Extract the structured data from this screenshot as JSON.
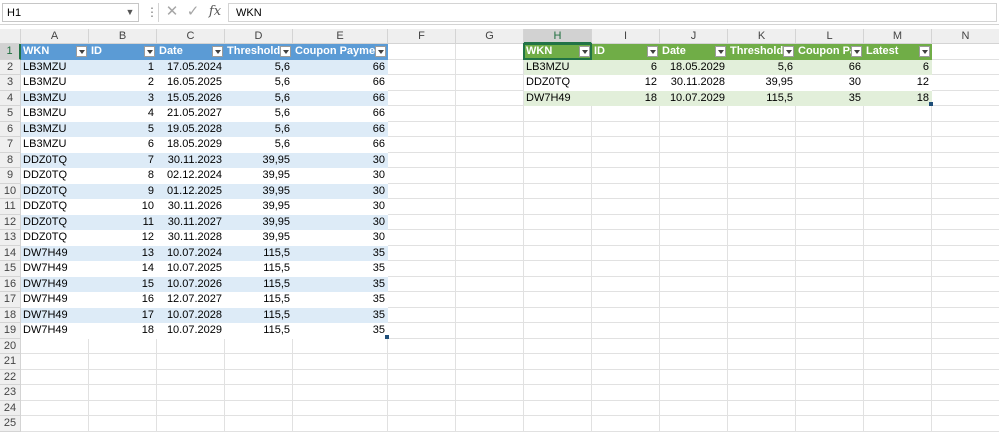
{
  "formula_bar": {
    "name_box": "H1",
    "formula": "WKN",
    "fx_label": "fx"
  },
  "columns": [
    "A",
    "B",
    "C",
    "D",
    "E",
    "F",
    "G",
    "H",
    "I",
    "J",
    "K",
    "L",
    "M",
    "N"
  ],
  "row_count": 25,
  "active_cell": "H1",
  "table1": {
    "headers": [
      "WKN",
      "ID",
      "Date",
      "Threshold",
      "Coupon Payment"
    ],
    "rows": [
      [
        "LB3MZU",
        "1",
        "17.05.2024",
        "5,6",
        "66"
      ],
      [
        "LB3MZU",
        "2",
        "16.05.2025",
        "5,6",
        "66"
      ],
      [
        "LB3MZU",
        "3",
        "15.05.2026",
        "5,6",
        "66"
      ],
      [
        "LB3MZU",
        "4",
        "21.05.2027",
        "5,6",
        "66"
      ],
      [
        "LB3MZU",
        "5",
        "19.05.2028",
        "5,6",
        "66"
      ],
      [
        "LB3MZU",
        "6",
        "18.05.2029",
        "5,6",
        "66"
      ],
      [
        "DDZ0TQ",
        "7",
        "30.11.2023",
        "39,95",
        "30"
      ],
      [
        "DDZ0TQ",
        "8",
        "02.12.2024",
        "39,95",
        "30"
      ],
      [
        "DDZ0TQ",
        "9",
        "01.12.2025",
        "39,95",
        "30"
      ],
      [
        "DDZ0TQ",
        "10",
        "30.11.2026",
        "39,95",
        "30"
      ],
      [
        "DDZ0TQ",
        "11",
        "30.11.2027",
        "39,95",
        "30"
      ],
      [
        "DDZ0TQ",
        "12",
        "30.11.2028",
        "39,95",
        "30"
      ],
      [
        "DW7H49",
        "13",
        "10.07.2024",
        "115,5",
        "35"
      ],
      [
        "DW7H49",
        "14",
        "10.07.2025",
        "115,5",
        "35"
      ],
      [
        "DW7H49",
        "15",
        "10.07.2026",
        "115,5",
        "35"
      ],
      [
        "DW7H49",
        "16",
        "12.07.2027",
        "115,5",
        "35"
      ],
      [
        "DW7H49",
        "17",
        "10.07.2028",
        "115,5",
        "35"
      ],
      [
        "DW7H49",
        "18",
        "10.07.2029",
        "115,5",
        "35"
      ]
    ]
  },
  "table2": {
    "headers": [
      "WKN",
      "ID",
      "Date",
      "Threshold",
      "Coupon Pay",
      "Latest"
    ],
    "rows": [
      [
        "LB3MZU",
        "6",
        "18.05.2029",
        "5,6",
        "66",
        "6"
      ],
      [
        "DDZ0TQ",
        "12",
        "30.11.2028",
        "39,95",
        "30",
        "12"
      ],
      [
        "DW7H49",
        "18",
        "10.07.2029",
        "115,5",
        "35",
        "18"
      ]
    ]
  }
}
